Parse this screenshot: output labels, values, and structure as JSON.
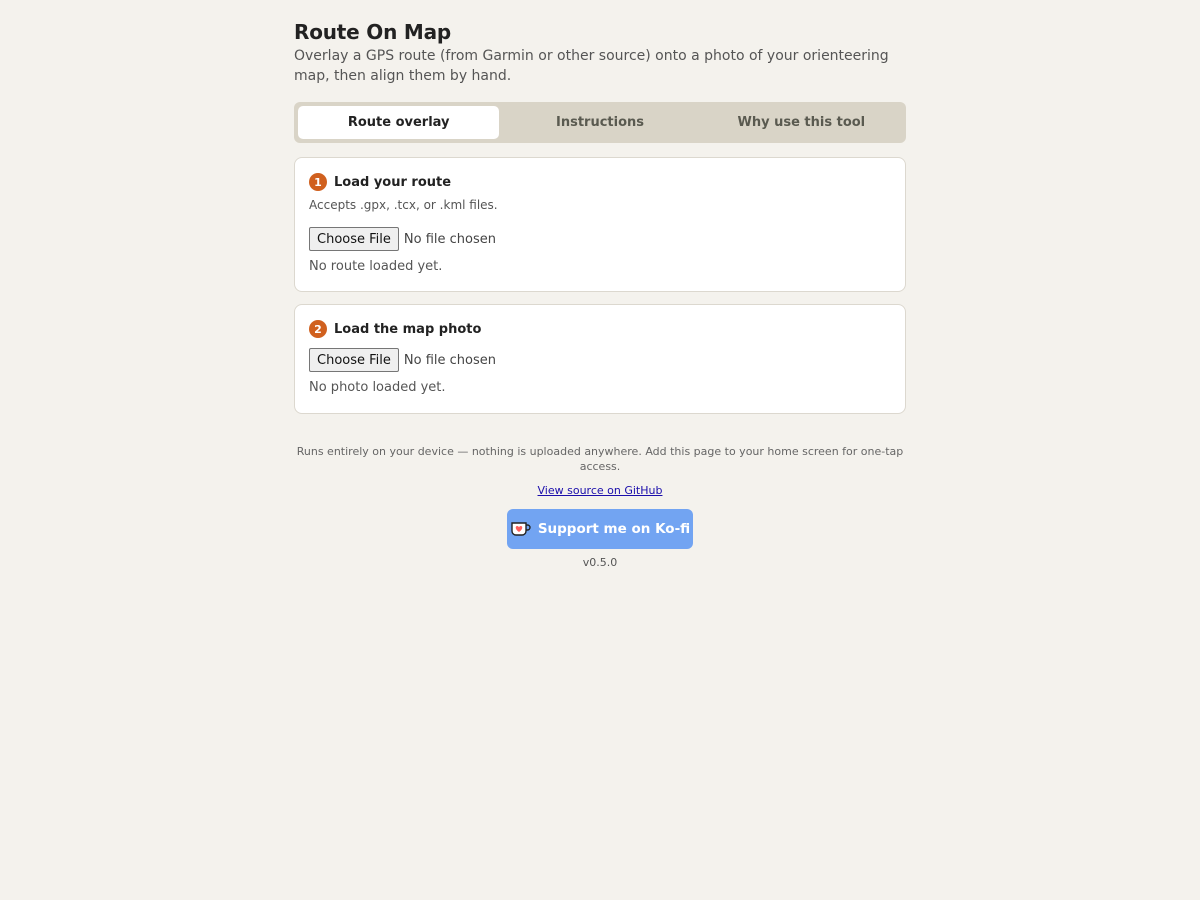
{
  "header": {
    "title": "Route On Map",
    "subtitle": "Overlay a GPS route (from Garmin or other source) onto a photo of your orienteering map, then align them by hand."
  },
  "tabs": [
    {
      "label": "Route overlay",
      "active": true
    },
    {
      "label": "Instructions",
      "active": false
    },
    {
      "label": "Why use this tool",
      "active": false
    }
  ],
  "route_card": {
    "step": "1",
    "title": "Load your route",
    "hint": "Accepts .gpx, .tcx, or .kml files.",
    "button_label": "Choose File",
    "file_status": "No file chosen",
    "status": "No route loaded yet."
  },
  "photo_card": {
    "step": "2",
    "title": "Load the map photo",
    "button_label": "Choose File",
    "file_status": "No file chosen",
    "status": "No photo loaded yet."
  },
  "footer": {
    "note": "Runs entirely on your device — nothing is uploaded anywhere. Add this page to your home screen for one-tap access.",
    "source_link": "View source on GitHub",
    "kofi_label": "Support me on Ko-fi",
    "version": "v0.5.0"
  },
  "colors": {
    "background": "#f4f2ed",
    "accent": "#d0601e",
    "kofi": "#72a4f2",
    "tab_bar": "#d9d4c7"
  }
}
